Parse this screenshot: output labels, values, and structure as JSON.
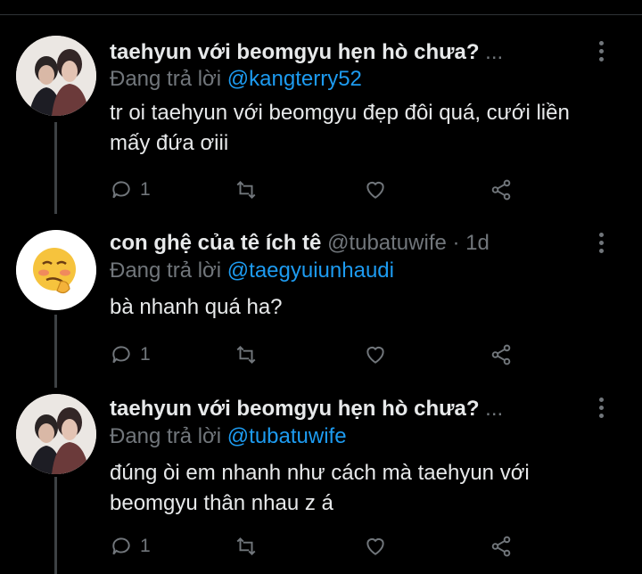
{
  "tweets": [
    {
      "name": "taehyun với beomgyu hẹn hò chưa?",
      "handle": "...",
      "reply_prefix": "Đang trả lời",
      "reply_to": "@kangterry52",
      "text": "tr oi taehyun với beomgyu đẹp đôi quá, cưới liền mấy đứa ơiii",
      "reply_count": "1",
      "avatar": "profile-photo"
    },
    {
      "name": "con ghệ của tê ích tê",
      "handle": "@tubatuwife · 1d",
      "reply_prefix": "Đang trả lời",
      "reply_to": "@taegyuiunhaudi",
      "text": "bà nhanh quá ha?",
      "reply_count": "1",
      "avatar": "woozy-face-emoji"
    },
    {
      "name": "taehyun với beomgyu hẹn hò chưa?",
      "handle": "...",
      "reply_prefix": "Đang trả lời",
      "reply_to": "@tubatuwife",
      "text": "đúng òi em nhanh như cách mà taehyun với beomgyu thân nhau z á",
      "reply_count": "1",
      "avatar": "profile-photo"
    }
  ],
  "icons": [
    "reply-icon",
    "retweet-icon",
    "like-icon",
    "share-icon",
    "more-icon"
  ],
  "colors": {
    "background": "#000000",
    "text": "#e7e9ea",
    "muted": "#71767b",
    "link": "#1d9bf0"
  }
}
